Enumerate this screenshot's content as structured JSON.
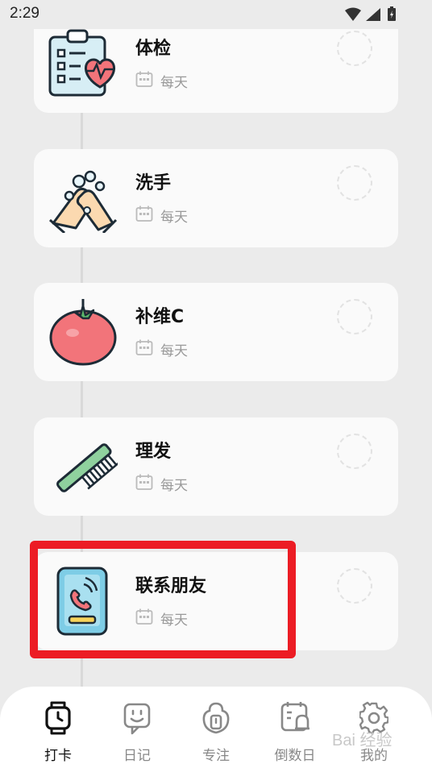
{
  "status_bar": {
    "time": "2:29"
  },
  "tasks": [
    {
      "title": "体检",
      "frequency": "每天",
      "icon": "health-checkup-clipboard-icon"
    },
    {
      "title": "洗手",
      "frequency": "每天",
      "icon": "hand-washing-icon"
    },
    {
      "title": "补维C",
      "frequency": "每天",
      "icon": "tomato-icon"
    },
    {
      "title": "理发",
      "frequency": "每天",
      "icon": "comb-icon"
    },
    {
      "title": "联系朋友",
      "frequency": "每天",
      "icon": "phone-call-icon"
    }
  ],
  "tab_bar": {
    "active": "打卡",
    "tabs": [
      {
        "label": "打卡",
        "icon": "watch-icon"
      },
      {
        "label": "日记",
        "icon": "smiley-note-icon"
      },
      {
        "label": "专注",
        "icon": "focus-timer-icon"
      },
      {
        "label": "倒数日",
        "icon": "calendar-alarm-icon"
      },
      {
        "label": "我的",
        "icon": "gear-icon"
      }
    ]
  },
  "watermark": "Bai 经验",
  "colors": {
    "highlight": "#ec1c24",
    "card_bg": "#fafafa",
    "page_bg": "#ebebeb",
    "active_tab": "#111111",
    "inactive_tab": "#888888"
  }
}
